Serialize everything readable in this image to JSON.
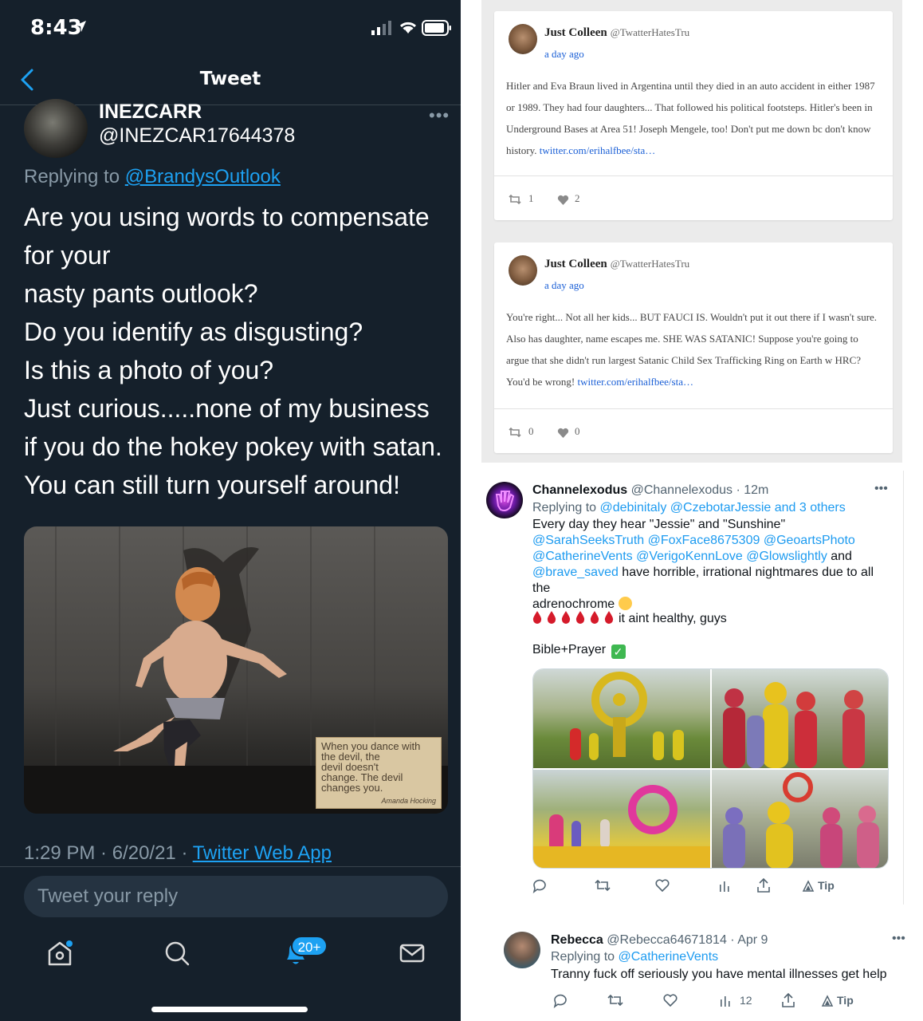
{
  "left": {
    "status": {
      "time": "8:43"
    },
    "nav": {
      "title": "Tweet"
    },
    "tweet": {
      "display_name": "INEZCARR",
      "handle": "@INEZCAR17644378",
      "replying_prefix": "Replying to",
      "replying_to": "@BrandysOutlook",
      "lines": [
        "Are you using words to compensate",
        "for your",
        "nasty pants outlook?",
        "Do you identify as disgusting?",
        "Is this a photo of you?",
        "Just curious.....none of my business",
        "if you do the hokey pokey with satan.",
        "You can still turn yourself around!"
      ],
      "image_caption_lines": [
        "When you dance with",
        "the devil, the",
        "devil doesn't",
        "change. The devil",
        "changes you."
      ],
      "image_caption_author": "Amanda Hocking",
      "timestamp": "1:29 PM · 6/20/21 · ",
      "source": "Twitter Web App"
    },
    "reply_placeholder": "Tweet your reply",
    "notifications_badge": "20+",
    "tab_icons": [
      "home-icon",
      "search-icon",
      "notifications-icon",
      "messages-icon"
    ]
  },
  "cards": [
    {
      "name": "Just Colleen",
      "handle": "@TwatterHatesTru",
      "time": "a day ago",
      "body": "Hitler and Eva Braun lived in Argentina until they died in an auto accident in either 1987 or 1989. They had four daughters... That followed his political footsteps. Hitler's been in Underground Bases at Area 51! Joseph Mengele, too! Don't put me down bc don't know history. ",
      "link": "twitter.com/erihalfbee/sta…",
      "reposts": "1",
      "likes": "2"
    },
    {
      "name": "Just Colleen",
      "handle": "@TwatterHatesTru",
      "time": "a day ago",
      "body": "You're right... Not all her kids... BUT FAUCI IS. Wouldn't put it out there if I wasn't sure. Also has daughter, name escapes me. SHE WAS SATANIC! Suppose you're going to argue that she didn't run largest Satanic Child Sex Trafficking Ring on Earth w HRC? You'd be wrong! ",
      "link": "twitter.com/erihalfbee/sta…",
      "reposts": "0",
      "likes": "0"
    }
  ],
  "mid_tweet": {
    "name": "Channelexodus",
    "handle_meta": " @Channelexodus · 12m",
    "replying_prefix": "Replying to ",
    "replying_to": "@debinitaly @CzebotarJessie and 3 others",
    "body_line1": "Every day they hear \"Jessie\" and \"Sunshine\"",
    "mentions_line1": "@SarahSeeksTruth @FoxFace8675309 @GeoartsPhoto",
    "mentions_line2": "@CatherineVents @VerigoKennLove @Glowslightly",
    "and_word": " and",
    "mention_last": "@brave_saved",
    "body_line3": " have horrible, irrational nightmares due to all the",
    "body_line4": "adrenochrome",
    "drops_text": "it aint healthy, guys",
    "bible_text": "Bible+Prayer",
    "tip_label": "Tip"
  },
  "bottom_tweet": {
    "name": "Rebecca",
    "handle_meta": " @Rebecca64671814 · Apr 9",
    "replying_prefix": "Replying to ",
    "replying_to": "@CatherineVents",
    "body": "Tranny fuck off seriously you have mental illnesses get help",
    "views": "12",
    "tip_label": "Tip"
  },
  "colors": {
    "dark_bg": "#15202b",
    "twitter_blue": "#1da1f2",
    "muted": "#8899a6",
    "card_bg": "#ebebeb",
    "link_blue": "#1a5fd6"
  }
}
